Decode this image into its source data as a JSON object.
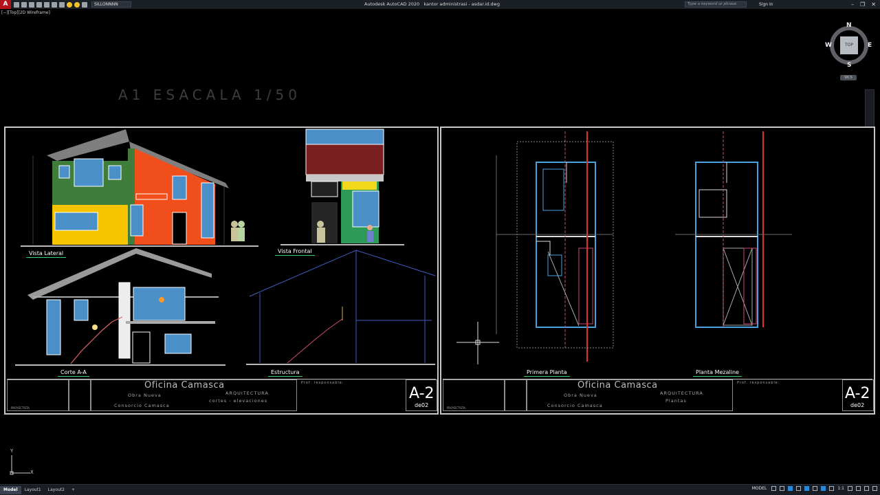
{
  "app": {
    "logo": "A",
    "title": "Autodesk AutoCAD 2020",
    "filename": "kantor administrasi - asdar.id.dwg",
    "layer": "SILLONNNN",
    "search_placeholder": "Type a keyword or phrase",
    "sign_in": "Sign In"
  },
  "viewport": {
    "label": "[−][Top][2D Wireframe]"
  },
  "viewcube": {
    "face": "TOP",
    "north": "N",
    "south": "S",
    "east": "E",
    "west": "W",
    "wcs": "WCS"
  },
  "heading": "A1 ESACALA 1/50",
  "sheet_left": {
    "labels": {
      "vista_lateral": "Vista Lateral",
      "vista_frontal": "Vista Frontal",
      "corte": "Corte A-A",
      "estructura": "Estructura"
    },
    "titleblock": {
      "office": "Oficina Camasca",
      "obra": "Obra Nueva",
      "consorcio": "Consorcio Camasca",
      "area": "ARQUITECTURA",
      "contenido": "cortes - elevaciones",
      "prof": "Prof. responsable:",
      "proyectista": "PROYECTISTA",
      "sheet_no": "A-2",
      "de": "de02"
    }
  },
  "sheet_right": {
    "labels": {
      "primera": "Primera Planta",
      "mezaline": "Planta Mezaline"
    },
    "titleblock": {
      "office": "Oficina Camasca",
      "obra": "Obra Nueva",
      "consorcio": "Consorcio Camasca",
      "area": "ARQUITECTURA",
      "contenido": "Plantas",
      "prof": "Prof. responsable:",
      "proyectista": "PROYECTISTA",
      "sheet_no": "A-2",
      "de": "de02"
    }
  },
  "ucs": {
    "x": "X",
    "y": "Y"
  },
  "statusbar": {
    "tabs": [
      "Model",
      "Layout1",
      "Layout2"
    ],
    "add": "+",
    "model_label": "MODEL",
    "scale": "1:1"
  },
  "colors": {
    "accent_red": "#b6121a",
    "sheet_border": "#c9c9c9",
    "label_underline": "#3ad36c"
  }
}
